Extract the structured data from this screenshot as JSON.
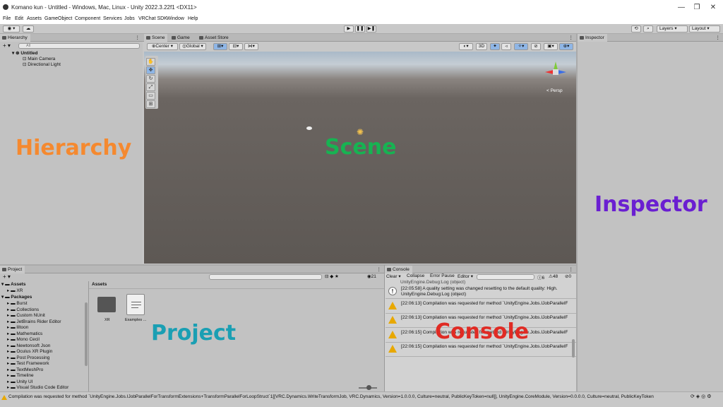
{
  "window": {
    "title": "Komano kun - Untitled - Windows, Mac, Linux - Unity 2022.3.22f1 <DX11>",
    "minimize": "—",
    "maximize": "❐",
    "close": "✕"
  },
  "menu": [
    "File",
    "Edit",
    "Assets",
    "GameObject",
    "Component",
    "Services",
    "Jobs",
    "VRChat SDK",
    "Window",
    "Help"
  ],
  "toolbar": {
    "layers": "Layers",
    "layout": "Layout",
    "play": "▶",
    "pause": "❚❚",
    "step": "▶❚"
  },
  "hierarchy": {
    "tab": "Hierarchy",
    "search_placeholder": "All",
    "scene": "Untitled",
    "items": [
      "Main Camera",
      "Directional Light"
    ],
    "overlay_label": "Hierarchy"
  },
  "scene": {
    "tabs": [
      "Scene",
      "Game",
      "Asset Store"
    ],
    "pivot": "Center",
    "space": "Global",
    "mode_2d": "3D",
    "persp": "< Persp",
    "overlay_label": "Scene",
    "tools": [
      "✋",
      "✥",
      "↻",
      "⤢",
      "▭",
      "⊞"
    ]
  },
  "inspector": {
    "tab": "Inspector",
    "overlay_label": "Inspector"
  },
  "project": {
    "tab": "Project",
    "tree_assets": "Assets",
    "tree_xr": "XR",
    "tree_packages": "Packages",
    "packages": [
      "Burst",
      "Collections",
      "Custom NUnit",
      "JetBrains Rider Editor",
      "liltoon",
      "Mathematics",
      "Mono Cecil",
      "Newtonsoft Json",
      "Oculus XR Plugin",
      "Post Processing",
      "Test Framework",
      "TextMeshPro",
      "Timeline",
      "Unity UI",
      "Visual Studio Code Editor",
      "Visual Studio Editor"
    ],
    "breadcrumb": "Assets",
    "files": [
      "XR",
      "Examples ..."
    ],
    "count": "21",
    "overlay_label": "Project"
  },
  "console": {
    "tab": "Console",
    "buttons": [
      "Clear",
      "Collapse",
      "Error Pause",
      "Editor"
    ],
    "counts": {
      "info": "6",
      "warn": "48",
      "error": "0"
    },
    "top_line": "UnityEngine.Debug:Log (object)",
    "entries": [
      {
        "type": "info",
        "line1": "[22:05:58] A quality setting was changed resetting to the default quality: High.",
        "line2": "UnityEngine.Debug:Log (object)"
      },
      {
        "type": "warn",
        "line1": "[22:06:13] Compilation was requested for method `UnityEngine.Jobs.IJobParallelF",
        "line2": ""
      },
      {
        "type": "warn",
        "line1": "[22:06:13] Compilation was requested for method `UnityEngine.Jobs.IJobParallelF",
        "line2": ""
      },
      {
        "type": "warn",
        "line1": "[22:06:15] Compilation was requested for method `UnityEngine.Jobs.IJobParallelF",
        "line2": ""
      },
      {
        "type": "warn",
        "line1": "[22:06:15] Compilation was requested for method `UnityEngine.Jobs.IJobParallelF",
        "line2": ""
      }
    ],
    "overlay_label": "Console"
  },
  "status": {
    "message": "Compilation was requested for method `UnityEngine.Jobs.IJobParallelForTransformExtensions+TransformParallelForLoopStruct`1[[VRC.Dynamics.WriteTransformJob, VRC.Dynamics, Version=1.0.0.0, Culture=neutral, PublicKeyToken=null]], UnityEngine.CoreModule, Version=0.0.0.0, Culture=neutral, PublicKeyToken"
  },
  "colors": {
    "hierarchy": "#f5892f",
    "scene": "#17b352",
    "inspector": "#6a1fd1",
    "project": "#1a9fb3",
    "console": "#e02b24"
  }
}
